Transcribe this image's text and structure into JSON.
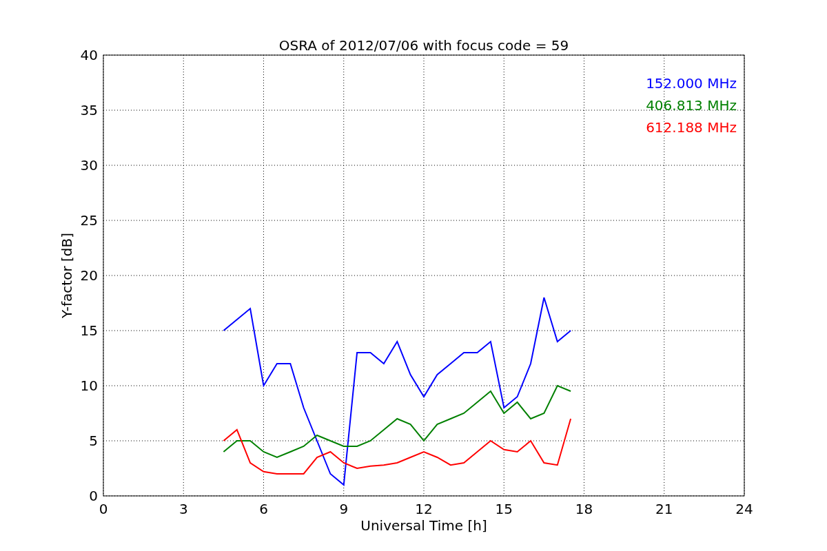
{
  "chart_data": {
    "type": "line",
    "title": "OSRA of 2012/07/06 with focus code = 59",
    "xlabel": "Universal Time [h]",
    "ylabel": "Y-factor [dB]",
    "x": [
      4.5,
      5,
      5.5,
      6,
      6.5,
      7,
      7.5,
      8,
      8.5,
      9,
      9.5,
      10,
      10.5,
      11,
      11.5,
      12,
      12.5,
      13,
      13.5,
      14,
      14.5,
      15,
      15.5,
      16,
      16.5,
      17,
      17.5
    ],
    "series": [
      {
        "name": "152.000 MHz",
        "color": "#0000ff",
        "values": [
          15,
          16,
          17,
          10,
          12,
          12,
          8,
          5,
          2,
          1,
          13,
          13,
          12,
          14,
          11,
          9,
          11,
          12,
          13,
          13,
          14,
          8,
          9,
          12,
          18,
          14,
          15
        ]
      },
      {
        "name": "406.813 MHz",
        "color": "#008000",
        "values": [
          4,
          5,
          5,
          4,
          3.5,
          4,
          4.5,
          5.5,
          5,
          4.5,
          4.5,
          5,
          6,
          7,
          6.5,
          5,
          6.5,
          7,
          7.5,
          8.5,
          9.5,
          7.5,
          8.5,
          7,
          7.5,
          10,
          9.5
        ]
      },
      {
        "name": "612.188 MHz",
        "color": "#ff0000",
        "values": [
          5,
          6,
          3,
          2.2,
          2,
          2,
          2,
          3.5,
          4,
          3,
          2.5,
          2.7,
          2.8,
          3,
          3.5,
          4,
          3.5,
          2.8,
          3,
          4,
          5,
          4.2,
          4,
          5,
          3,
          2.8,
          7
        ]
      }
    ],
    "xlim": [
      0,
      24
    ],
    "ylim": [
      0,
      40
    ],
    "xticks": [
      0,
      3,
      6,
      9,
      12,
      15,
      18,
      21,
      24
    ],
    "yticks": [
      0,
      5,
      10,
      15,
      20,
      25,
      30,
      35,
      40
    ],
    "grid": true
  }
}
